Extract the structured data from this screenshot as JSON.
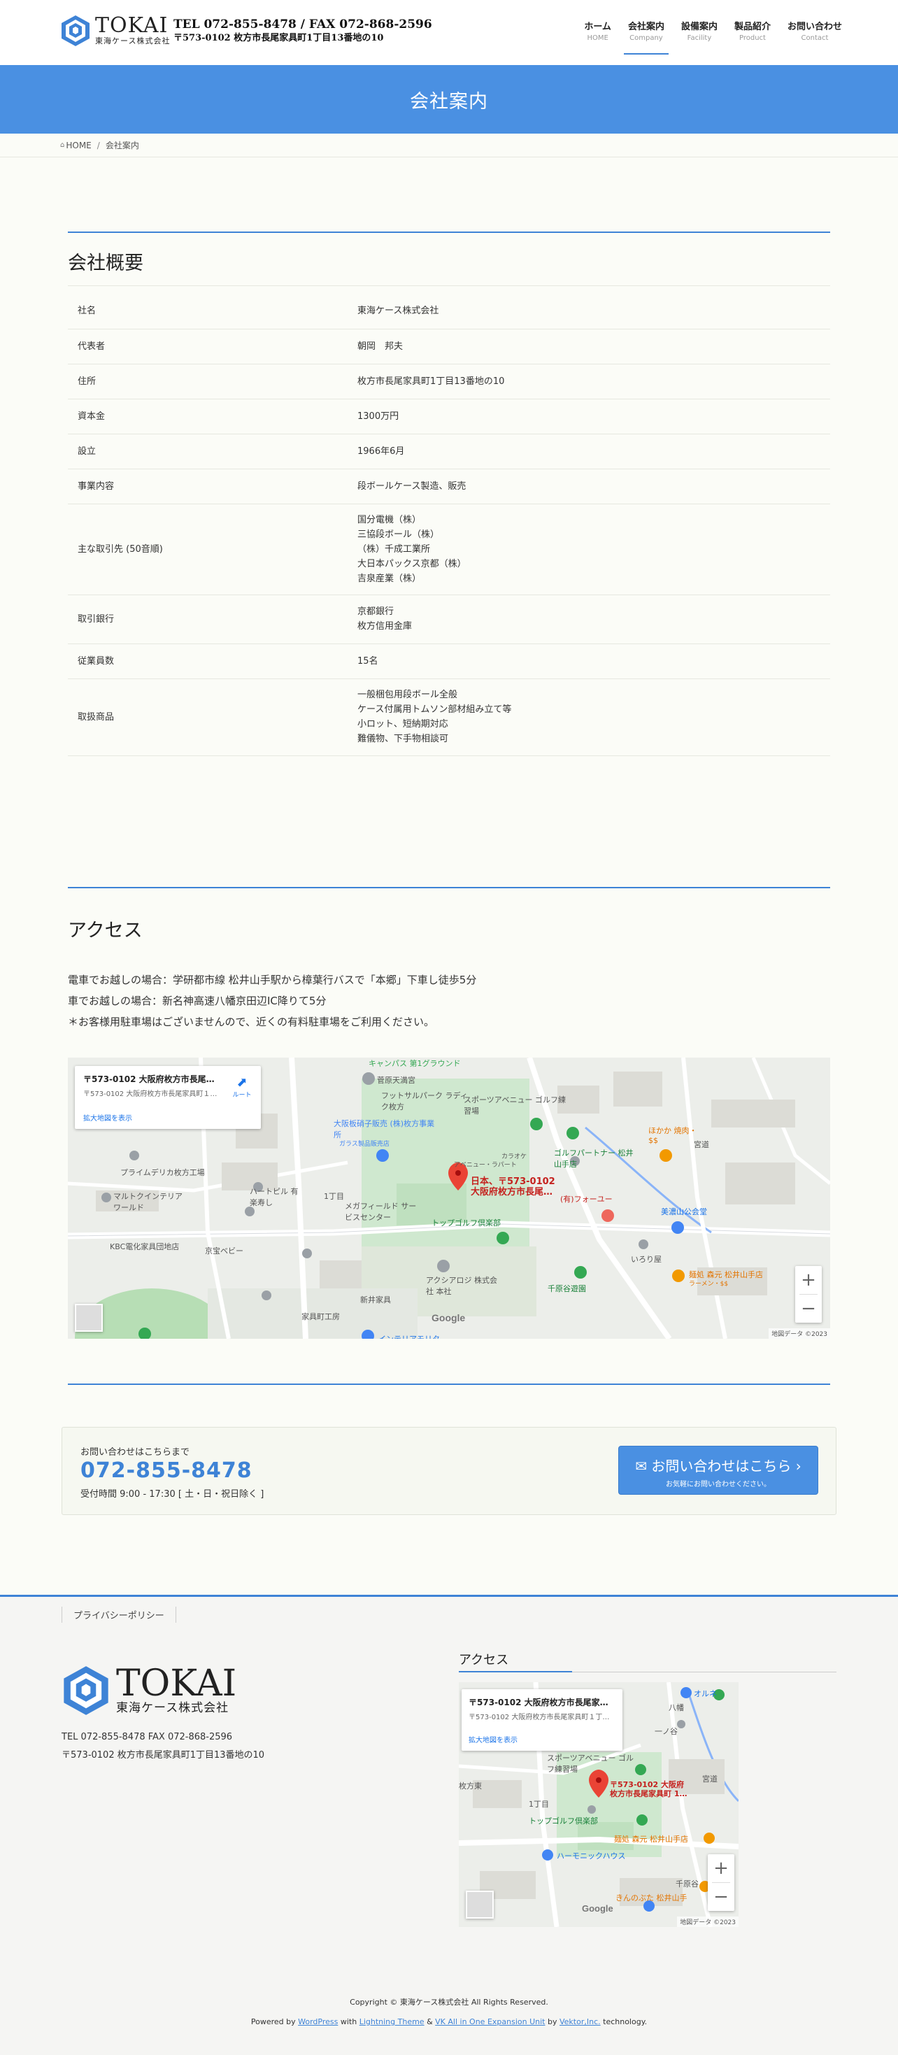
{
  "header": {
    "brand_name": "TOKAI",
    "brand_sub": "東海ケース株式会社",
    "tel_line": "TEL 072-855-8478 / FAX 072-868-2596",
    "address_line": "〒573-0102 枚方市長尾家具町1丁目13番地の10",
    "nav": [
      {
        "label": "ホーム",
        "sub": "HOME"
      },
      {
        "label": "会社案内",
        "sub": "Company"
      },
      {
        "label": "設備案内",
        "sub": "Facility"
      },
      {
        "label": "製品紹介",
        "sub": "Product"
      },
      {
        "label": "お問い合わせ",
        "sub": "Contact"
      }
    ]
  },
  "page": {
    "title": "会社案内"
  },
  "breadcrumb": {
    "home": "HOME",
    "current": "会社案内"
  },
  "company": {
    "title": "会社概要",
    "rows": [
      {
        "label": "社名",
        "value": [
          "東海ケース株式会社"
        ]
      },
      {
        "label": "代表者",
        "value": [
          "朝岡　邦夫"
        ]
      },
      {
        "label": "住所",
        "value": [
          "枚方市長尾家具町1丁目13番地の10"
        ]
      },
      {
        "label": "資本金",
        "value": [
          "1300万円"
        ]
      },
      {
        "label": "設立",
        "value": [
          "1966年6月"
        ]
      },
      {
        "label": "事業内容",
        "value": [
          "段ボールケース製造、販売"
        ]
      },
      {
        "label": "主な取引先 (50音順)",
        "value": [
          "国分電機（株）",
          "三協段ボール（株）",
          "（株）千成工業所",
          "大日本パックス京都（株）",
          "吉泉産業（株）"
        ]
      },
      {
        "label": "取引銀行",
        "value": [
          "京都銀行",
          "枚方信用金庫"
        ]
      },
      {
        "label": "従業員数",
        "value": [
          "15名"
        ]
      },
      {
        "label": "取扱商品",
        "value": [
          "一般梱包用段ボール全般",
          "ケース付属用トムソン部材組み立て等",
          "小ロット、短納期対応",
          "難儀物、下手物相談可"
        ]
      }
    ]
  },
  "access": {
    "title": "アクセス",
    "lines": [
      "電車でお越しの場合：学研都市線 松井山手駅から樟葉行バスで「本郷」下車し徒歩5分",
      "車でお越しの場合：新名神高速八幡京田辺IC降りて5分",
      "＊お客様用駐車場はございませんので、近くの有料駐車場をご利用ください。"
    ],
    "map": {
      "card_title": "〒573-0102 大阪府枚方市長尾家具町１丁目１３−１０",
      "card_sub": "〒573-0102 大阪府枚方市長尾家具町１丁目１３−１０",
      "card_link": "拡大地図を表示",
      "directions": "ルート",
      "pin_label_1": "日本、〒573-0102",
      "pin_label_2": "大阪府枚方市長尾…",
      "places": [
        "キャンパス 第1グラウンド",
        "菅原天満宮",
        "フットサルパーク ラディク枚方",
        "スポーツアベニュー ゴルフ練習場",
        "大阪板硝子販売 (株)枚方事業所",
        "ガラス製品販売店",
        "ほかか 焼肉・$$",
        "宮道",
        "ゴルフパートナー 松井山手店",
        "(有)フォーユー",
        "美濃山公会堂",
        "プライムデリカ枚方工場",
        "マルトクインテリア ワールド",
        "ハートピル 有楽寿し",
        "1丁目",
        "メガフィールド サービスセンター",
        "トップゴルフ倶楽部",
        "KBC電化家具団地店",
        "京宝ベビー",
        "千原谷遊園",
        "アクシアロジ 株式会社 本社",
        "新井家具",
        "家具町工房",
        "インテリアモリタ",
        "いろり屋",
        "麺処 森元 松井山手店",
        "ラーメン・$$",
        "カラオケ",
        "アベニュー・ラパート"
      ],
      "attribution": "地図データ ©2023"
    }
  },
  "contact": {
    "lead": "お問い合わせはこちらまで",
    "tel": "072-855-8478",
    "hours": "受付時間 9:00 - 17:30 [ 土・日・祝日除く ]",
    "button": "お問い合わせはこちら",
    "button_sub": "お気軽にお問い合わせください。"
  },
  "footer": {
    "nav": [
      "プライバシーポリシー"
    ],
    "brand_name": "TOKAI",
    "brand_sub": "東海ケース株式会社",
    "tel": "TEL 072-855-8478 FAX 072-868-2596",
    "address": "〒573-0102 枚方市長尾家具町1丁目13番地の10",
    "access_title": "アクセス",
    "map": {
      "card_title": "〒573-0102 大阪府枚方市長尾家具町１丁目１３−１０",
      "card_sub": "〒573-0102 大阪府枚方市長尾家具町１丁目１３−１０",
      "card_link": "拡大地図を表示",
      "pin_label_1": "〒573-0102 大阪府",
      "pin_label_2": "枚方市長尾家具町 1…",
      "places": [
        "オルネ",
        "八幡",
        "一ノ谷",
        "スポーツアベニュー ゴルフ練習場",
        "宮道",
        "トップゴルフ倶楽部",
        "麺処 森元 松井山手店",
        "ハーモニックハウス",
        "千原谷",
        "きんのぶた 松井山手",
        "1丁目",
        "枚方東"
      ],
      "attribution": "地図データ ©2023"
    },
    "copyright": "Copyright © 東海ケース株式会社 All Rights Reserved.",
    "powered_prefix": "Powered by",
    "powered_wp": "WordPress",
    "powered_with": "with",
    "powered_theme": "Lightning Theme",
    "powered_amp": "&",
    "powered_vk": "VK All in One Expansion Unit",
    "powered_by": "by",
    "powered_vektor": "Vektor,Inc.",
    "powered_suffix": "technology."
  },
  "colors": {
    "accent": "#4a90e2",
    "pin": "#ea4335",
    "park": "#c8e6c9"
  }
}
